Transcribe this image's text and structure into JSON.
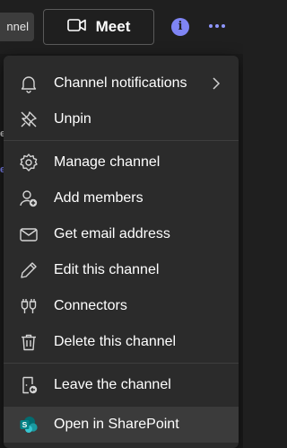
{
  "topbar": {
    "channel_chip": "nnel",
    "meet_label": "Meet",
    "info_glyph": "i"
  },
  "menu": {
    "items": [
      {
        "label": "Channel notifications",
        "icon": "bell-icon",
        "has_submenu": true
      },
      {
        "label": "Unpin",
        "icon": "unpin-icon"
      },
      {
        "label": "Manage channel",
        "icon": "gear-icon"
      },
      {
        "label": "Add members",
        "icon": "add-person-icon"
      },
      {
        "label": "Get email address",
        "icon": "mail-icon"
      },
      {
        "label": "Edit this channel",
        "icon": "pencil-icon"
      },
      {
        "label": "Connectors",
        "icon": "plug-icon"
      },
      {
        "label": "Delete this channel",
        "icon": "trash-icon"
      },
      {
        "label": "Leave the channel",
        "icon": "leave-door-icon"
      },
      {
        "label": "Open in SharePoint",
        "icon": "sharepoint-icon"
      }
    ]
  },
  "colors": {
    "accent": "#7f85f5",
    "menu_bg": "#2b2b2b",
    "sharepoint": "#038387"
  }
}
